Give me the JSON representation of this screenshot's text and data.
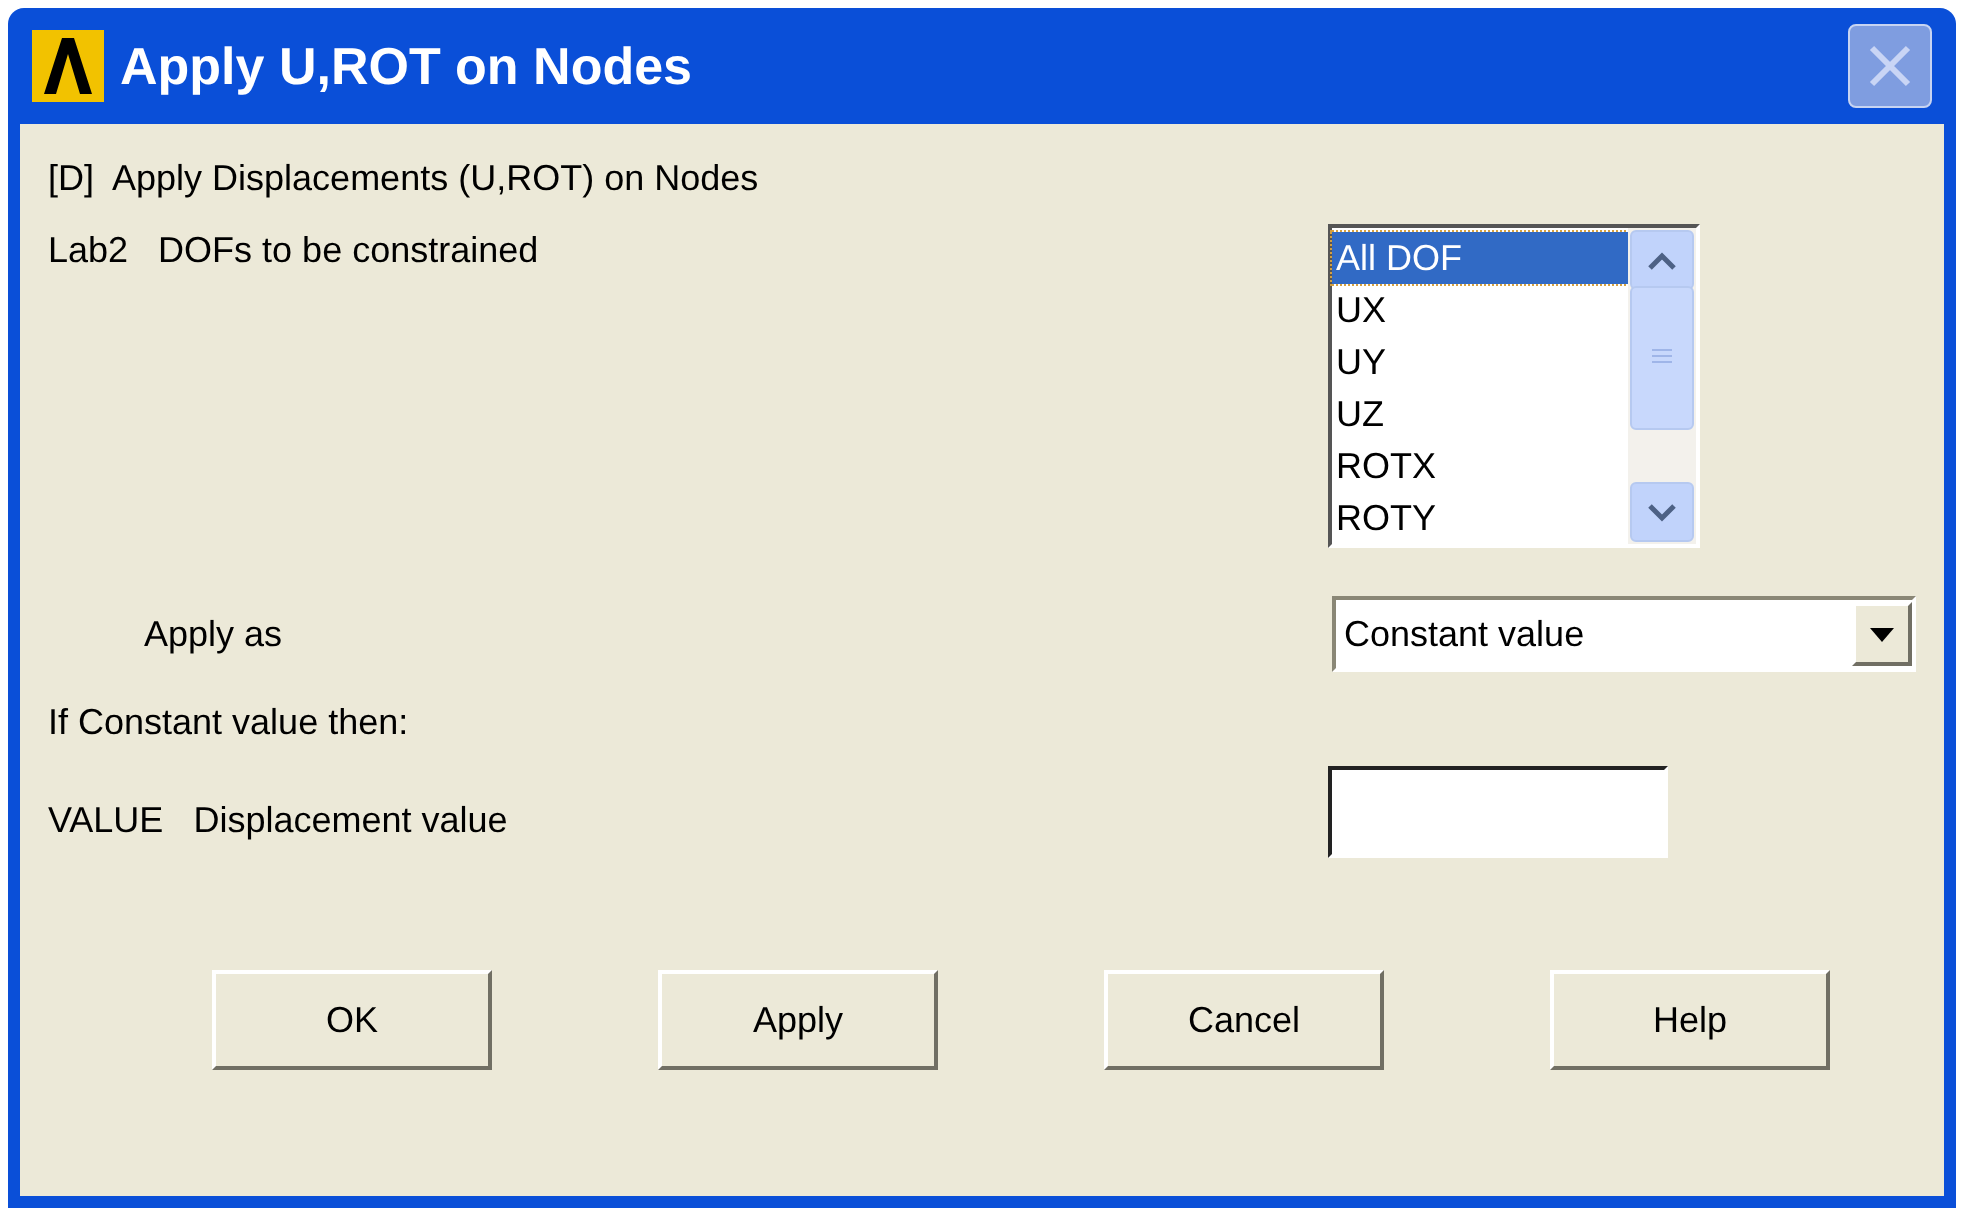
{
  "window": {
    "title": "Apply U,ROT on Nodes"
  },
  "heading": "[D]  Apply Displacements (U,ROT) on Nodes",
  "lab2": {
    "label": "Lab2   DOFs to be constrained",
    "items": [
      {
        "label": "All DOF",
        "selected": true
      },
      {
        "label": "UX",
        "selected": false
      },
      {
        "label": "UY",
        "selected": false
      },
      {
        "label": "UZ",
        "selected": false
      },
      {
        "label": "ROTX",
        "selected": false
      },
      {
        "label": "ROTY",
        "selected": false
      }
    ]
  },
  "apply_as": {
    "label": "Apply as",
    "value": "Constant value"
  },
  "note": "If Constant value then:",
  "value_field": {
    "label": "VALUE   Displacement value"
  },
  "buttons": [
    "OK",
    "Apply",
    "Cancel",
    "Help"
  ]
}
